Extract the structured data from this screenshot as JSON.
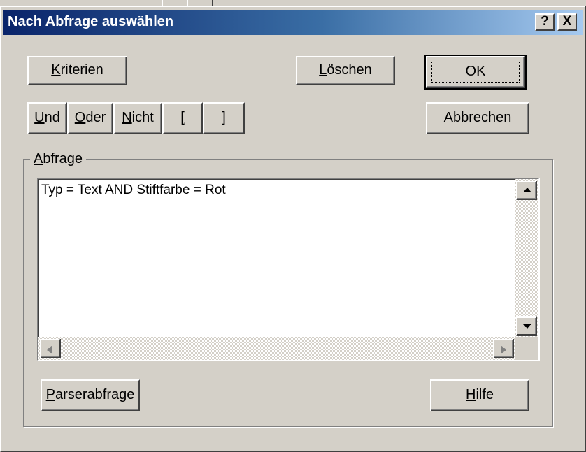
{
  "window": {
    "title": "Nach Abfrage auswählen",
    "help_button": "?",
    "close_button": "X"
  },
  "buttons": {
    "kriterien": {
      "mnemonic": "K",
      "rest": "riterien"
    },
    "loeschen": {
      "mnemonic": "L",
      "rest": "öschen"
    },
    "ok": "OK",
    "und": {
      "mnemonic": "U",
      "rest": "nd"
    },
    "oder": {
      "mnemonic": "O",
      "rest": "der"
    },
    "nicht": {
      "mnemonic": "N",
      "rest": "icht"
    },
    "open_paren": {
      "mnemonic": "[",
      "rest": ""
    },
    "close_paren": "]",
    "abbrechen": "Abbrechen",
    "parserabfrage": {
      "mnemonic": "P",
      "rest": "arserabfrage"
    },
    "hilfe": {
      "mnemonic": "H",
      "rest": "ilfe"
    }
  },
  "query_group": {
    "label_mnemonic": "A",
    "label_rest": "bfrage",
    "text": "Typ = Text  AND Stiftfarbe = Rot"
  },
  "icons": [
    "scroll-up-arrow-icon",
    "scroll-down-arrow-icon",
    "scroll-left-arrow-icon",
    "scroll-right-arrow-icon"
  ],
  "colors": {
    "titlebar_start": "#0a246a",
    "titlebar_end": "#a6caf0",
    "face": "#d4d0c8"
  }
}
